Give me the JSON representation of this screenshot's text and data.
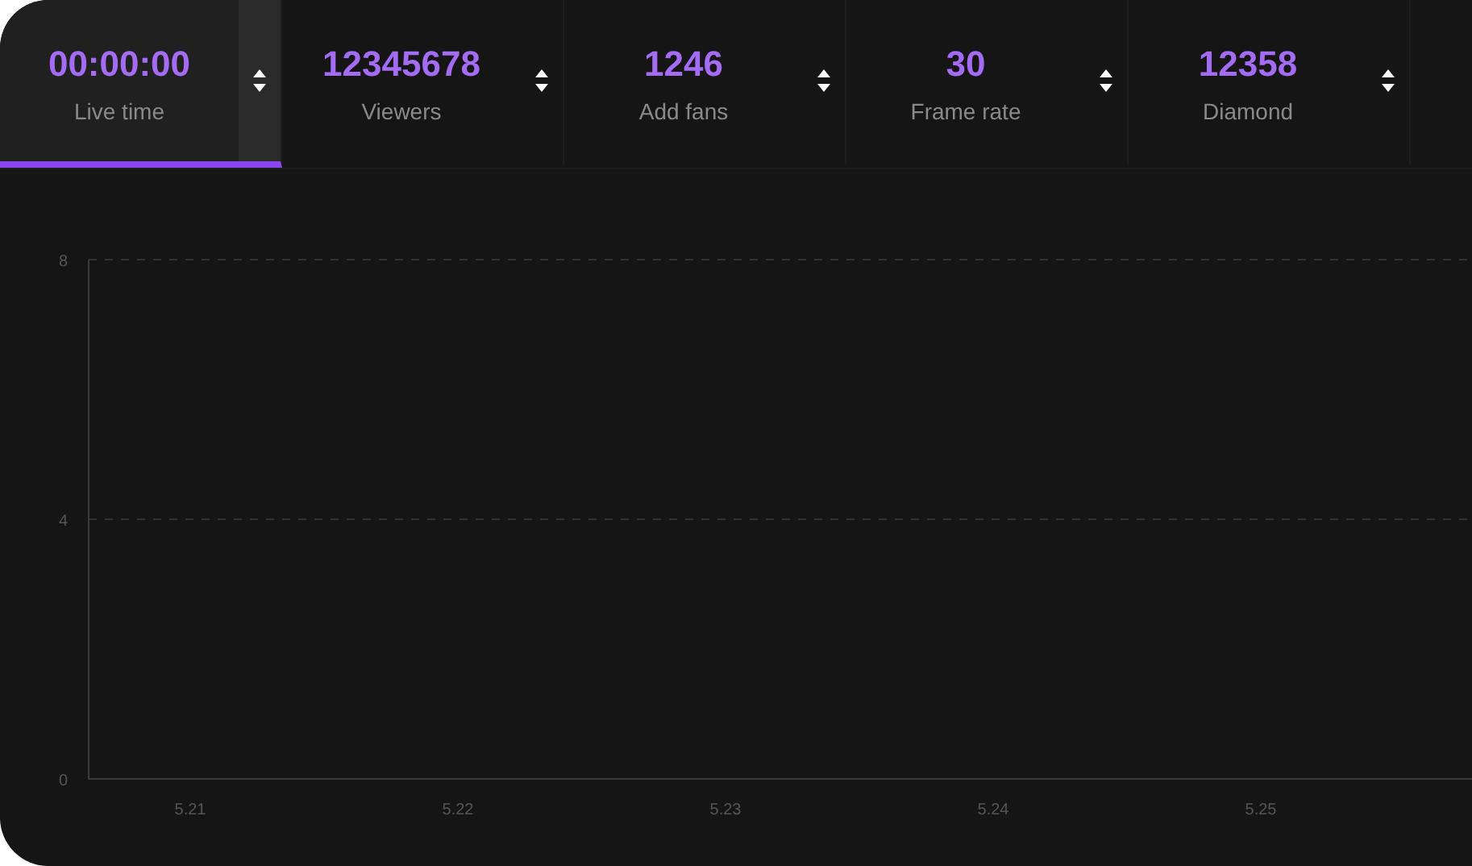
{
  "tabs": [
    {
      "value": "00:00:00",
      "label": "Live time",
      "selected": true
    },
    {
      "value": "12345678",
      "label": "Viewers",
      "selected": false
    },
    {
      "value": "1246",
      "label": "Add fans",
      "selected": false
    },
    {
      "value": "30",
      "label": "Frame rate",
      "selected": false
    },
    {
      "value": "12358",
      "label": "Diamond",
      "selected": false
    }
  ],
  "chart": {
    "chart_data": {
      "type": "line",
      "categories": [
        "5.21",
        "5.22",
        "5.23",
        "5.24",
        "5.25"
      ],
      "ylim": [
        0,
        8
      ],
      "yticks": [
        0,
        4,
        8
      ]
    }
  }
}
